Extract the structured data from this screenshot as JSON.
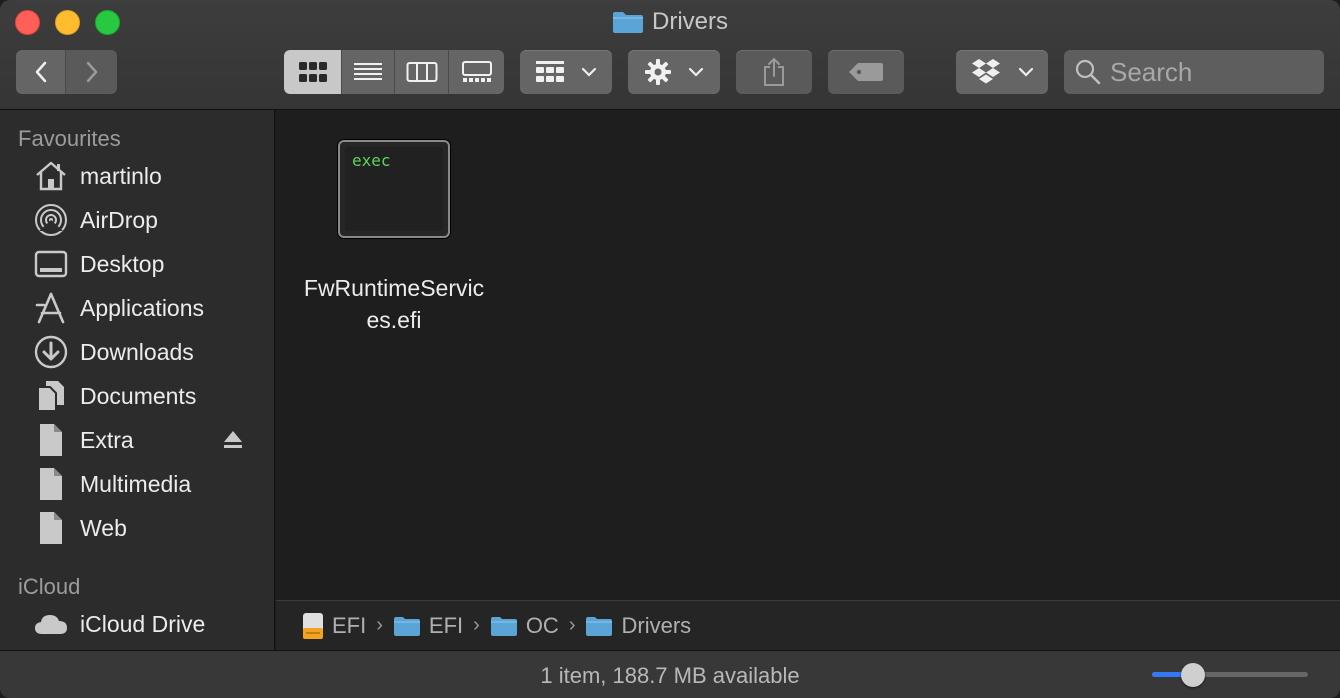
{
  "window": {
    "title": "Drivers",
    "accent": "#3478f6",
    "folder_color": "#5aa4d8"
  },
  "toolbar": {
    "back_icon": "chevron-left-icon",
    "forward_icon": "chevron-right-icon",
    "view_modes": [
      "icon-view",
      "list-view",
      "column-view",
      "gallery-view"
    ],
    "active_view": "icon-view",
    "group_icon": "group-by-icon",
    "action_icon": "gear-icon",
    "share_icon": "share-icon",
    "tag_icon": "tag-icon",
    "dropbox_icon": "dropbox-icon",
    "search": {
      "placeholder": "Search",
      "value": ""
    }
  },
  "sidebar": {
    "sections": [
      {
        "title": "Favourites",
        "items": [
          {
            "label": "martinlo",
            "icon": "home-icon"
          },
          {
            "label": "AirDrop",
            "icon": "airdrop-icon"
          },
          {
            "label": "Desktop",
            "icon": "desktop-icon"
          },
          {
            "label": "Applications",
            "icon": "applications-icon"
          },
          {
            "label": "Downloads",
            "icon": "downloads-icon"
          },
          {
            "label": "Documents",
            "icon": "documents-icon"
          },
          {
            "label": "Extra",
            "icon": "document-icon",
            "eject": true
          },
          {
            "label": "Multimedia",
            "icon": "document-icon"
          },
          {
            "label": "Web",
            "icon": "document-icon"
          }
        ]
      },
      {
        "title": "iCloud",
        "items": [
          {
            "label": "iCloud Drive",
            "icon": "cloud-icon"
          }
        ]
      }
    ]
  },
  "content": {
    "files": [
      {
        "name": "FwRuntimeServices.efi",
        "name_line1": "FwRuntimeServic",
        "name_line2": "es.efi",
        "icon_text": "exec",
        "icon": "exec-icon"
      }
    ]
  },
  "pathbar": {
    "crumbs": [
      {
        "label": "EFI",
        "icon": "drive-icon"
      },
      {
        "label": "EFI",
        "icon": "folder-icon"
      },
      {
        "label": "OC",
        "icon": "folder-icon"
      },
      {
        "label": "Drivers",
        "icon": "folder-icon"
      }
    ]
  },
  "status": {
    "text": "1 item, 188.7 MB available",
    "zoom_fraction": 0.26
  }
}
